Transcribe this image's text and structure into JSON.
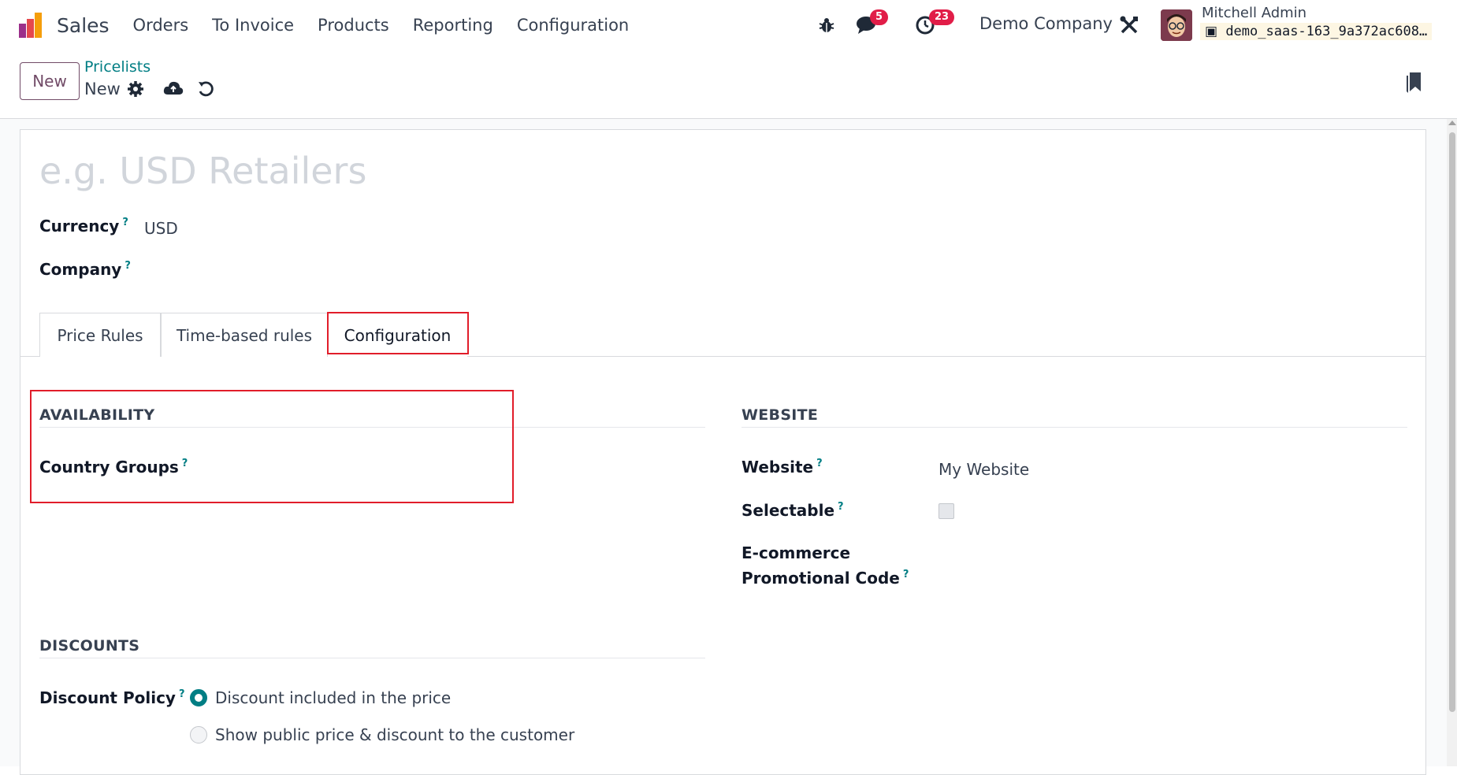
{
  "navbar": {
    "app_name": "Sales",
    "menu": [
      "Orders",
      "To Invoice",
      "Products",
      "Reporting",
      "Configuration"
    ],
    "messages_count": "5",
    "activities_count": "23",
    "company": "Demo Company",
    "user_name": "Mitchell Admin",
    "database": "demo_saas-163_9a372ac608…"
  },
  "control_panel": {
    "new_button": "New",
    "breadcrumb": "Pricelists",
    "record_name": "New"
  },
  "form": {
    "name_placeholder": "e.g. USD Retailers",
    "currency_label": "Currency",
    "currency_value": "USD",
    "company_label": "Company",
    "help_mark": "?"
  },
  "tabs": {
    "price_rules": "Price Rules",
    "time_based": "Time-based rules",
    "configuration": "Configuration",
    "active": "Configuration"
  },
  "availability": {
    "title": "AVAILABILITY",
    "country_groups_label": "Country Groups"
  },
  "website": {
    "title": "WEBSITE",
    "website_label": "Website",
    "website_value": "My Website",
    "selectable_label": "Selectable",
    "selectable_checked": false,
    "promo_label_line1": "E-commerce",
    "promo_label_line2": "Promotional Code"
  },
  "discounts": {
    "title": "DISCOUNTS",
    "policy_label": "Discount Policy",
    "option_included": "Discount included in the price",
    "option_public": "Show public price & discount to the customer",
    "selected": "Discount included in the price"
  },
  "colors": {
    "primary": "#714b67",
    "accent": "#017e84",
    "badge": "#e11d48",
    "highlight": "#e11d2a"
  },
  "icons": {
    "debug": "bug-icon",
    "messages": "chat-icon",
    "activities": "clock-icon",
    "settings": "tools-icon",
    "gear": "gear-icon",
    "save": "cloud-upload-icon",
    "discard": "undo-icon",
    "bookmark": "bookmark-icon"
  }
}
